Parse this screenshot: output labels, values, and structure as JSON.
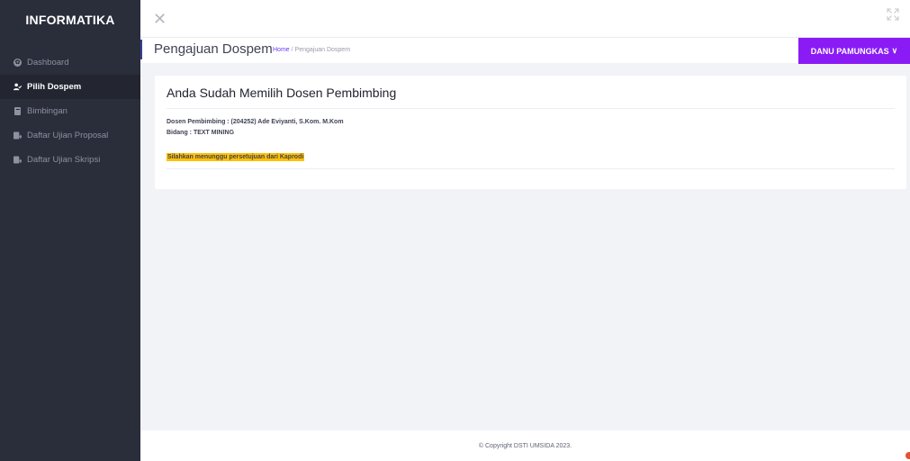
{
  "sidebar": {
    "brand": "INFORMATIKA",
    "items": [
      {
        "label": "Dashboard",
        "icon": "dashboard-icon"
      },
      {
        "label": "Pilih Dospem",
        "icon": "user-check-icon",
        "active": true
      },
      {
        "label": "Bimbingan",
        "icon": "book-icon"
      },
      {
        "label": "Daftar Ujian Proposal",
        "icon": "book-arrow-icon"
      },
      {
        "label": "Daftar Ujian Skripsi",
        "icon": "book-arrow-icon"
      }
    ]
  },
  "topbar": {
    "close_icon": "close-icon",
    "expand_icon": "fullscreen-icon"
  },
  "subheader": {
    "title": "Pengajuan Dospem",
    "breadcrumb_home": "Home",
    "breadcrumb_sep": "/",
    "breadcrumb_current": "Pengajuan Dospem",
    "user_name": "DANU PAMUNGKAS",
    "user_chevron": "∨"
  },
  "card": {
    "title": "Anda Sudah Memilih Dosen Pembimbing",
    "dosen_line": "Dosen Pembimbing : (204252) Ade Eviyanti, S.Kom. M.Kom",
    "bidang_line": "Bidang : TEXT MINING",
    "notice": "Silahkan menunggu persetujuan dari Kaprodi"
  },
  "footer": {
    "copyright": "© Copyright DSTI UMSIDA 2023."
  },
  "colors": {
    "sidebar_bg": "#2a2d3a",
    "accent_purple": "#8a1bf5",
    "notice_yellow": "#ffc107",
    "page_bg": "#f1f3f7"
  }
}
